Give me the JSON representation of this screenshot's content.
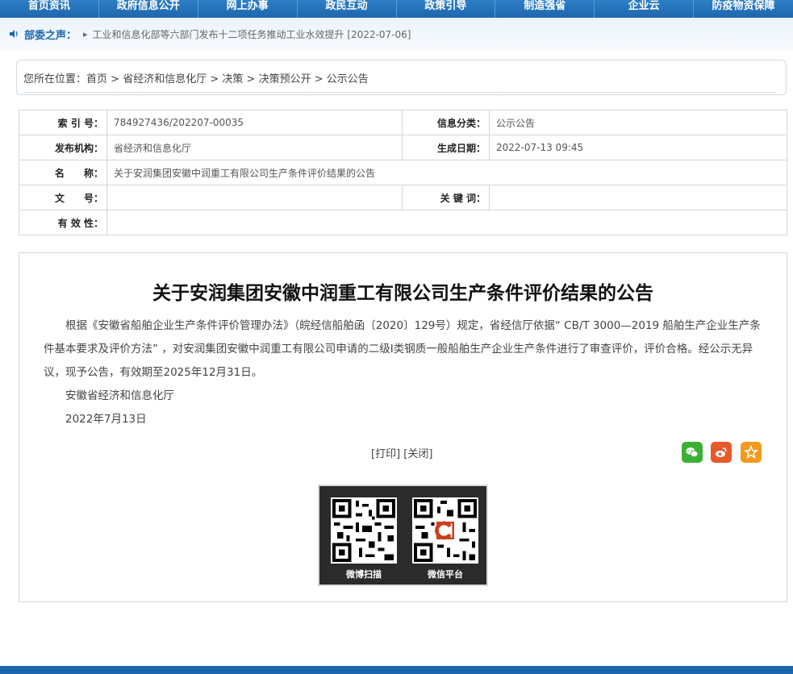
{
  "nav": {
    "items": [
      "首页资讯",
      "政府信息公开",
      "网上办事",
      "政民互动",
      "政策引导",
      "制造强省",
      "企业云",
      "防疫物资保障"
    ]
  },
  "news": {
    "label": "部委之声：",
    "arrow": "▸",
    "link": "工业和信息化部等六部门发布十二项任务推动工业水效提升 [2022-07-06]"
  },
  "breadcrumb": {
    "prefix": "您所在位置：",
    "items": [
      "首页",
      "省经济和信息化厅",
      "决策",
      "决策预公开",
      "公示公告"
    ],
    "separator": " > "
  },
  "meta": {
    "index_label": "索 引 号：",
    "index_value": "784927436/202207-00035",
    "category_label": "信息分类：",
    "category_value": "公示公告",
    "publisher_label": "发布机构：",
    "publisher_value": "省经济和信息化厅",
    "date_label": "生成日期：",
    "date_value": "2022-07-13 09:45",
    "name_label": "名　　称：",
    "name_value": "关于安润集团安徽中润重工有限公司生产条件评价结果的公告",
    "docno_label": "文　　号：",
    "docno_value": "",
    "keyword_label": "关 键 词：",
    "keyword_value": "",
    "validity_label": "有 效 性：",
    "validity_value": ""
  },
  "article": {
    "title": "关于安润集团安徽中润重工有限公司生产条件评价结果的公告",
    "body": "根据《安徽省船舶企业生产条件评价管理办法》（皖经信船舶函〔2020〕129号）规定，省经信厅依据“ CB/T 3000—2019 船舶生产企业生产条件基本要求及评价方法” ，对安润集团安徽中润重工有限公司申请的二级Ⅰ类钢质一般船舶生产企业生产条件进行了审查评价，评价合格。经公示无异议，现予公告，有效期至2025年12月31日。",
    "signature": "安徽省经济和信息化厅",
    "date": "2022年7月13日"
  },
  "actions": {
    "print": "[打印]",
    "close": "[关闭]"
  },
  "share": {
    "wechat_color": "#3cb034",
    "weibo_color": "#e8592a",
    "favorite_color": "#f39a1e"
  },
  "qr": {
    "weibo_caption": "微博扫描",
    "wechat_caption": "微信平台"
  }
}
